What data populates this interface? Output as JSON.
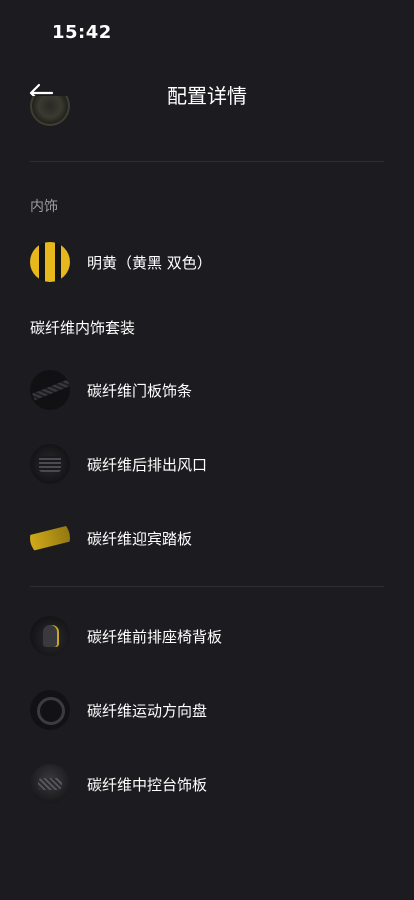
{
  "status_bar": {
    "time": "15:42"
  },
  "header": {
    "title": "配置详情"
  },
  "interior": {
    "section_label": "内饰",
    "color_option": {
      "label": "明黄（黄黑 双色）",
      "icon": "yellow-black-swatch-icon"
    }
  },
  "carbon_kit": {
    "title": "碳纤维内饰套装",
    "items": [
      {
        "label": "碳纤维门板饰条",
        "icon": "door-trim-thumbnail"
      },
      {
        "label": "碳纤维后排出风口",
        "icon": "rear-air-vent-thumbnail"
      },
      {
        "label": "碳纤维迎宾踏板",
        "icon": "door-sill-thumbnail"
      }
    ]
  },
  "carbon_more": {
    "items": [
      {
        "label": "碳纤维前排座椅背板",
        "icon": "seat-back-thumbnail"
      },
      {
        "label": "碳纤维运动方向盘",
        "icon": "steering-wheel-thumbnail"
      },
      {
        "label": "碳纤维中控台饰板",
        "icon": "center-console-thumbnail"
      }
    ]
  },
  "colors": {
    "background": "#1c1c20",
    "accent_yellow": "#e6b81e",
    "divider": "#2e2e33",
    "muted_text": "#9a9aa0"
  }
}
